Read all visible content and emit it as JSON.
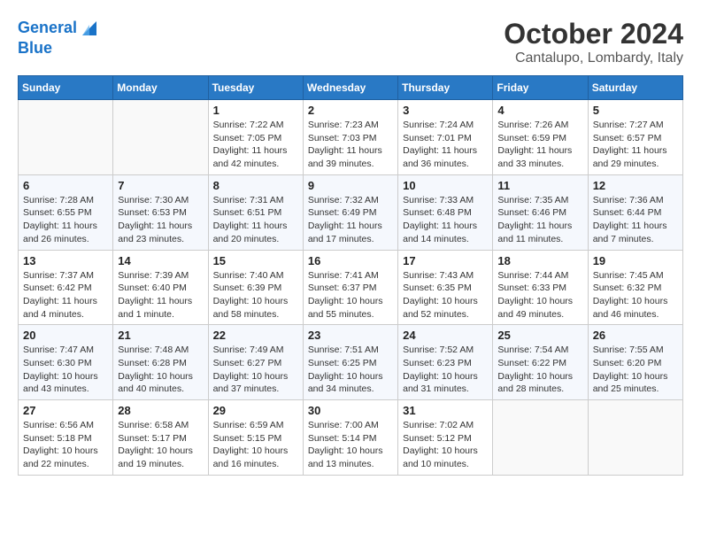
{
  "header": {
    "logo_line1": "General",
    "logo_line2": "Blue",
    "month_title": "October 2024",
    "location": "Cantalupo, Lombardy, Italy"
  },
  "days_of_week": [
    "Sunday",
    "Monday",
    "Tuesday",
    "Wednesday",
    "Thursday",
    "Friday",
    "Saturday"
  ],
  "weeks": [
    [
      {
        "day": "",
        "info": ""
      },
      {
        "day": "",
        "info": ""
      },
      {
        "day": "1",
        "info": "Sunrise: 7:22 AM\nSunset: 7:05 PM\nDaylight: 11 hours and 42 minutes."
      },
      {
        "day": "2",
        "info": "Sunrise: 7:23 AM\nSunset: 7:03 PM\nDaylight: 11 hours and 39 minutes."
      },
      {
        "day": "3",
        "info": "Sunrise: 7:24 AM\nSunset: 7:01 PM\nDaylight: 11 hours and 36 minutes."
      },
      {
        "day": "4",
        "info": "Sunrise: 7:26 AM\nSunset: 6:59 PM\nDaylight: 11 hours and 33 minutes."
      },
      {
        "day": "5",
        "info": "Sunrise: 7:27 AM\nSunset: 6:57 PM\nDaylight: 11 hours and 29 minutes."
      }
    ],
    [
      {
        "day": "6",
        "info": "Sunrise: 7:28 AM\nSunset: 6:55 PM\nDaylight: 11 hours and 26 minutes."
      },
      {
        "day": "7",
        "info": "Sunrise: 7:30 AM\nSunset: 6:53 PM\nDaylight: 11 hours and 23 minutes."
      },
      {
        "day": "8",
        "info": "Sunrise: 7:31 AM\nSunset: 6:51 PM\nDaylight: 11 hours and 20 minutes."
      },
      {
        "day": "9",
        "info": "Sunrise: 7:32 AM\nSunset: 6:49 PM\nDaylight: 11 hours and 17 minutes."
      },
      {
        "day": "10",
        "info": "Sunrise: 7:33 AM\nSunset: 6:48 PM\nDaylight: 11 hours and 14 minutes."
      },
      {
        "day": "11",
        "info": "Sunrise: 7:35 AM\nSunset: 6:46 PM\nDaylight: 11 hours and 11 minutes."
      },
      {
        "day": "12",
        "info": "Sunrise: 7:36 AM\nSunset: 6:44 PM\nDaylight: 11 hours and 7 minutes."
      }
    ],
    [
      {
        "day": "13",
        "info": "Sunrise: 7:37 AM\nSunset: 6:42 PM\nDaylight: 11 hours and 4 minutes."
      },
      {
        "day": "14",
        "info": "Sunrise: 7:39 AM\nSunset: 6:40 PM\nDaylight: 11 hours and 1 minute."
      },
      {
        "day": "15",
        "info": "Sunrise: 7:40 AM\nSunset: 6:39 PM\nDaylight: 10 hours and 58 minutes."
      },
      {
        "day": "16",
        "info": "Sunrise: 7:41 AM\nSunset: 6:37 PM\nDaylight: 10 hours and 55 minutes."
      },
      {
        "day": "17",
        "info": "Sunrise: 7:43 AM\nSunset: 6:35 PM\nDaylight: 10 hours and 52 minutes."
      },
      {
        "day": "18",
        "info": "Sunrise: 7:44 AM\nSunset: 6:33 PM\nDaylight: 10 hours and 49 minutes."
      },
      {
        "day": "19",
        "info": "Sunrise: 7:45 AM\nSunset: 6:32 PM\nDaylight: 10 hours and 46 minutes."
      }
    ],
    [
      {
        "day": "20",
        "info": "Sunrise: 7:47 AM\nSunset: 6:30 PM\nDaylight: 10 hours and 43 minutes."
      },
      {
        "day": "21",
        "info": "Sunrise: 7:48 AM\nSunset: 6:28 PM\nDaylight: 10 hours and 40 minutes."
      },
      {
        "day": "22",
        "info": "Sunrise: 7:49 AM\nSunset: 6:27 PM\nDaylight: 10 hours and 37 minutes."
      },
      {
        "day": "23",
        "info": "Sunrise: 7:51 AM\nSunset: 6:25 PM\nDaylight: 10 hours and 34 minutes."
      },
      {
        "day": "24",
        "info": "Sunrise: 7:52 AM\nSunset: 6:23 PM\nDaylight: 10 hours and 31 minutes."
      },
      {
        "day": "25",
        "info": "Sunrise: 7:54 AM\nSunset: 6:22 PM\nDaylight: 10 hours and 28 minutes."
      },
      {
        "day": "26",
        "info": "Sunrise: 7:55 AM\nSunset: 6:20 PM\nDaylight: 10 hours and 25 minutes."
      }
    ],
    [
      {
        "day": "27",
        "info": "Sunrise: 6:56 AM\nSunset: 5:18 PM\nDaylight: 10 hours and 22 minutes."
      },
      {
        "day": "28",
        "info": "Sunrise: 6:58 AM\nSunset: 5:17 PM\nDaylight: 10 hours and 19 minutes."
      },
      {
        "day": "29",
        "info": "Sunrise: 6:59 AM\nSunset: 5:15 PM\nDaylight: 10 hours and 16 minutes."
      },
      {
        "day": "30",
        "info": "Sunrise: 7:00 AM\nSunset: 5:14 PM\nDaylight: 10 hours and 13 minutes."
      },
      {
        "day": "31",
        "info": "Sunrise: 7:02 AM\nSunset: 5:12 PM\nDaylight: 10 hours and 10 minutes."
      },
      {
        "day": "",
        "info": ""
      },
      {
        "day": "",
        "info": ""
      }
    ]
  ]
}
